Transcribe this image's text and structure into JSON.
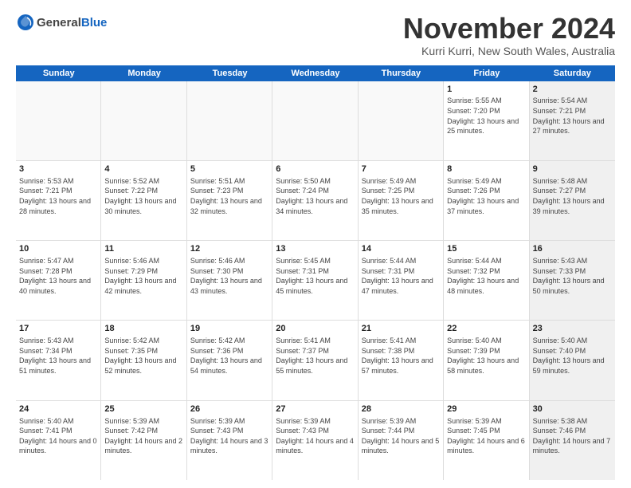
{
  "logo": {
    "general": "General",
    "blue": "Blue"
  },
  "title": "November 2024",
  "location": "Kurri Kurri, New South Wales, Australia",
  "header_days": [
    "Sunday",
    "Monday",
    "Tuesday",
    "Wednesday",
    "Thursday",
    "Friday",
    "Saturday"
  ],
  "weeks": [
    [
      {
        "day": "",
        "info": ""
      },
      {
        "day": "",
        "info": ""
      },
      {
        "day": "",
        "info": ""
      },
      {
        "day": "",
        "info": ""
      },
      {
        "day": "",
        "info": ""
      },
      {
        "day": "1",
        "info": "Sunrise: 5:55 AM\nSunset: 7:20 PM\nDaylight: 13 hours\nand 25 minutes."
      },
      {
        "day": "2",
        "info": "Sunrise: 5:54 AM\nSunset: 7:21 PM\nDaylight: 13 hours\nand 27 minutes."
      }
    ],
    [
      {
        "day": "3",
        "info": "Sunrise: 5:53 AM\nSunset: 7:21 PM\nDaylight: 13 hours\nand 28 minutes."
      },
      {
        "day": "4",
        "info": "Sunrise: 5:52 AM\nSunset: 7:22 PM\nDaylight: 13 hours\nand 30 minutes."
      },
      {
        "day": "5",
        "info": "Sunrise: 5:51 AM\nSunset: 7:23 PM\nDaylight: 13 hours\nand 32 minutes."
      },
      {
        "day": "6",
        "info": "Sunrise: 5:50 AM\nSunset: 7:24 PM\nDaylight: 13 hours\nand 34 minutes."
      },
      {
        "day": "7",
        "info": "Sunrise: 5:49 AM\nSunset: 7:25 PM\nDaylight: 13 hours\nand 35 minutes."
      },
      {
        "day": "8",
        "info": "Sunrise: 5:49 AM\nSunset: 7:26 PM\nDaylight: 13 hours\nand 37 minutes."
      },
      {
        "day": "9",
        "info": "Sunrise: 5:48 AM\nSunset: 7:27 PM\nDaylight: 13 hours\nand 39 minutes."
      }
    ],
    [
      {
        "day": "10",
        "info": "Sunrise: 5:47 AM\nSunset: 7:28 PM\nDaylight: 13 hours\nand 40 minutes."
      },
      {
        "day": "11",
        "info": "Sunrise: 5:46 AM\nSunset: 7:29 PM\nDaylight: 13 hours\nand 42 minutes."
      },
      {
        "day": "12",
        "info": "Sunrise: 5:46 AM\nSunset: 7:30 PM\nDaylight: 13 hours\nand 43 minutes."
      },
      {
        "day": "13",
        "info": "Sunrise: 5:45 AM\nSunset: 7:31 PM\nDaylight: 13 hours\nand 45 minutes."
      },
      {
        "day": "14",
        "info": "Sunrise: 5:44 AM\nSunset: 7:31 PM\nDaylight: 13 hours\nand 47 minutes."
      },
      {
        "day": "15",
        "info": "Sunrise: 5:44 AM\nSunset: 7:32 PM\nDaylight: 13 hours\nand 48 minutes."
      },
      {
        "day": "16",
        "info": "Sunrise: 5:43 AM\nSunset: 7:33 PM\nDaylight: 13 hours\nand 50 minutes."
      }
    ],
    [
      {
        "day": "17",
        "info": "Sunrise: 5:43 AM\nSunset: 7:34 PM\nDaylight: 13 hours\nand 51 minutes."
      },
      {
        "day": "18",
        "info": "Sunrise: 5:42 AM\nSunset: 7:35 PM\nDaylight: 13 hours\nand 52 minutes."
      },
      {
        "day": "19",
        "info": "Sunrise: 5:42 AM\nSunset: 7:36 PM\nDaylight: 13 hours\nand 54 minutes."
      },
      {
        "day": "20",
        "info": "Sunrise: 5:41 AM\nSunset: 7:37 PM\nDaylight: 13 hours\nand 55 minutes."
      },
      {
        "day": "21",
        "info": "Sunrise: 5:41 AM\nSunset: 7:38 PM\nDaylight: 13 hours\nand 57 minutes."
      },
      {
        "day": "22",
        "info": "Sunrise: 5:40 AM\nSunset: 7:39 PM\nDaylight: 13 hours\nand 58 minutes."
      },
      {
        "day": "23",
        "info": "Sunrise: 5:40 AM\nSunset: 7:40 PM\nDaylight: 13 hours\nand 59 minutes."
      }
    ],
    [
      {
        "day": "24",
        "info": "Sunrise: 5:40 AM\nSunset: 7:41 PM\nDaylight: 14 hours\nand 0 minutes."
      },
      {
        "day": "25",
        "info": "Sunrise: 5:39 AM\nSunset: 7:42 PM\nDaylight: 14 hours\nand 2 minutes."
      },
      {
        "day": "26",
        "info": "Sunrise: 5:39 AM\nSunset: 7:43 PM\nDaylight: 14 hours\nand 3 minutes."
      },
      {
        "day": "27",
        "info": "Sunrise: 5:39 AM\nSunset: 7:43 PM\nDaylight: 14 hours\nand 4 minutes."
      },
      {
        "day": "28",
        "info": "Sunrise: 5:39 AM\nSunset: 7:44 PM\nDaylight: 14 hours\nand 5 minutes."
      },
      {
        "day": "29",
        "info": "Sunrise: 5:39 AM\nSunset: 7:45 PM\nDaylight: 14 hours\nand 6 minutes."
      },
      {
        "day": "30",
        "info": "Sunrise: 5:38 AM\nSunset: 7:46 PM\nDaylight: 14 hours\nand 7 minutes."
      }
    ]
  ]
}
